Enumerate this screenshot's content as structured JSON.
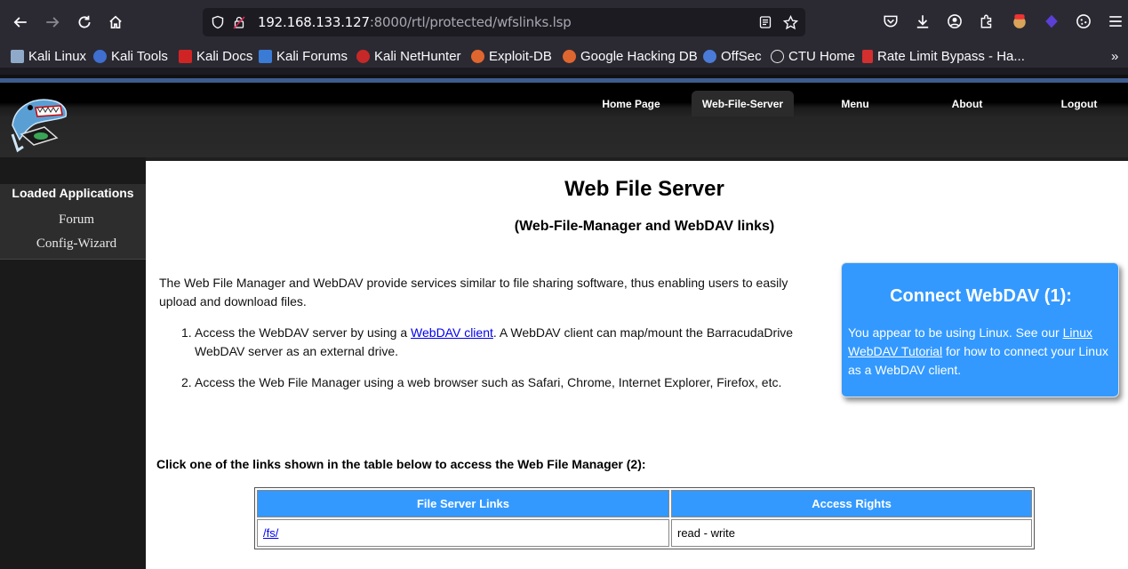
{
  "browser": {
    "url_host": "192.168.133.127",
    "url_rest": ":8000/rtl/protected/wfslinks.lsp",
    "bookmarks": [
      {
        "label": "Kali Linux",
        "color": "#8fa9c9"
      },
      {
        "label": "Kali Tools",
        "color": "#3e6fd1"
      },
      {
        "label": "Kali Docs",
        "color": "#d02424"
      },
      {
        "label": "Kali Forums",
        "color": "#3a7bd5"
      },
      {
        "label": "Kali NetHunter",
        "color": "#c62828"
      },
      {
        "label": "Exploit-DB",
        "color": "#e0662f"
      },
      {
        "label": "Google Hacking DB",
        "color": "#e0662f"
      },
      {
        "label": "OffSec",
        "color": "#4a7bd8"
      },
      {
        "label": "CTU Home",
        "color": "#e8e8e8"
      },
      {
        "label": "Rate Limit Bypass - Ha...",
        "color": "#d32f2f"
      }
    ]
  },
  "nav": {
    "home": "Home Page",
    "wfs": "Web-File-Server",
    "menu": "Menu",
    "about": "About",
    "logout": "Logout"
  },
  "sidebar": {
    "title": "Loaded Applications",
    "items": [
      "Forum",
      "Config-Wizard"
    ]
  },
  "main": {
    "title": "Web File Server",
    "subtitle": "(Web-File-Manager and WebDAV links)",
    "intro": "The Web File Manager and WebDAV provide services similar to file sharing software, thus enabling users to easily upload and download files.",
    "step1_pre": "Access the WebDAV server by using a ",
    "step1_link": "WebDAV client",
    "step1_post": ". A WebDAV client can map/mount the BarracudaDrive WebDAV server as an external drive.",
    "step2": "Access the Web File Manager using a web browser such as Safari, Chrome, Internet Explorer, Firefox, etc.",
    "click_hint": "Click one of the links shown in the table below to access the Web File Manager (2):",
    "table": {
      "headers": [
        "File Server Links",
        "Access Rights"
      ],
      "rows": [
        [
          "/fs/",
          "read - write"
        ]
      ]
    }
  },
  "webdav_box": {
    "title": "Connect WebDAV (1):",
    "text_pre": "You appear to be using Linux. See our ",
    "link": "Linux WebDAV Tutorial",
    "text_post": " for how to connect your Linux as a WebDAV client."
  },
  "colors": {
    "accent": "#3399ff",
    "link": "#0000ee"
  }
}
